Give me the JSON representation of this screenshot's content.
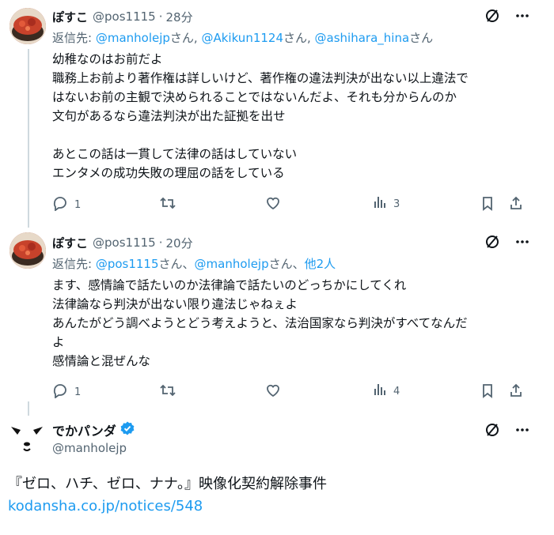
{
  "tweets": [
    {
      "name": "ぽすこ",
      "handle": "@pos1115",
      "separator": "·",
      "time": "28分",
      "reply_prefix": "返信先: ",
      "reply_links": [
        "@manholejp",
        "@Akikun1124",
        "@ashihara_hina"
      ],
      "reply_suffix": "さん",
      "reply_sep": "さん, ",
      "body": "幼稚なのはお前だよ\n職務上お前より著作権は詳しいけど、著作権の違法判決が出ない以上違法で\nはないお前の主観で決められることではないんだよ、それも分からんのか\n文句があるなら違法判決が出た証拠を出せ\n\nあとこの話は一貫して法律の話はしていない\nエンタメの成功失敗の理屈の話をしている",
      "replies": "1",
      "views": "3"
    },
    {
      "name": "ぽすこ",
      "handle": "@pos1115",
      "separator": "·",
      "time": "20分",
      "reply_prefix": "返信先: ",
      "reply_links": [
        "@pos1115",
        "@manholejp",
        "他2人"
      ],
      "reply_mid_sep": "さん、",
      "body": "ます、感情論で話たいのか法律論で話たいのどっちかにしてくれ\n法律論なら判決が出ない限り違法じゃねぇよ\nあんたがどう調べようとどう考えようと、法治国家なら判決がすべてなんだ\nよ\n感情論と混ぜんな",
      "replies": "1",
      "views": "4"
    }
  ],
  "main_tweet": {
    "name": "でかパンダ",
    "handle": "@manholejp",
    "text": "『ゼロ、ハチ、ゼロ、ナナ。』映像化契約解除事件",
    "link": "kodansha.co.jp/notices/548"
  },
  "icons": {
    "grok": "grok-icon",
    "more": "more-icon",
    "reply": "reply-icon",
    "retweet": "retweet-icon",
    "like": "like-icon",
    "views": "views-icon",
    "bookmark": "bookmark-icon",
    "share": "share-icon"
  },
  "colors": {
    "link": "#1d9bf0",
    "muted": "#536471",
    "text": "#0f1419",
    "verified": "#1d9bf0"
  }
}
